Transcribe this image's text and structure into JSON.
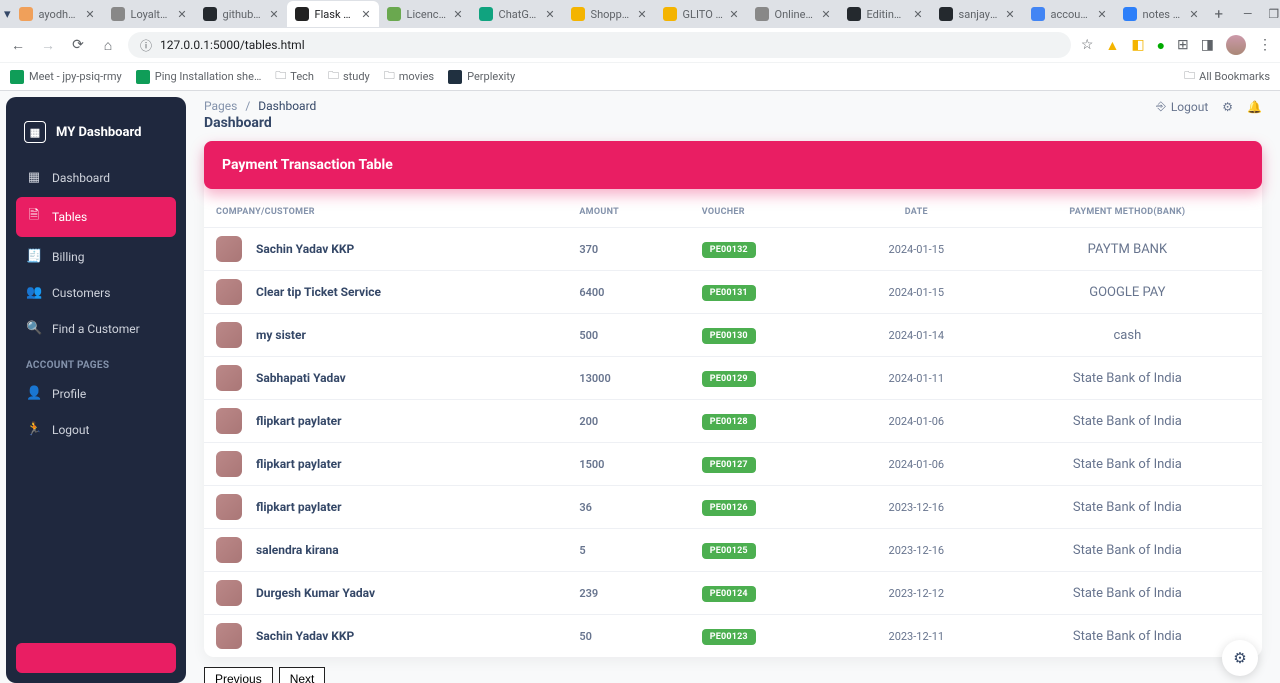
{
  "browser": {
    "tabs": [
      {
        "title": "ayodhya a",
        "favicon": "#f0a05a"
      },
      {
        "title": "Loyalty-D",
        "favicon": "#888"
      },
      {
        "title": "github.co",
        "favicon": "#24292e"
      },
      {
        "title": "Flask Mate",
        "favicon": "#222",
        "active": true
      },
      {
        "title": "Licence D",
        "favicon": "#6aa84f"
      },
      {
        "title": "ChatGPT",
        "favicon": "#10a37f"
      },
      {
        "title": "Shopping",
        "favicon": "#f4b400"
      },
      {
        "title": "GLITO Ful",
        "favicon": "#f4b400"
      },
      {
        "title": "Online MY",
        "favicon": "#888"
      },
      {
        "title": "Editing ex",
        "favicon": "#24292e"
      },
      {
        "title": "sanjayeng",
        "favicon": "#24292e"
      },
      {
        "title": "accounts",
        "favicon": "#4285f4"
      },
      {
        "title": "notes — P",
        "favicon": "#2d7ff9"
      }
    ],
    "url": "127.0.0.1:5000/tables.html",
    "bookmarks": [
      {
        "type": "item",
        "label": "Meet - jpy-psiq-rmy",
        "color": "#0f9d58"
      },
      {
        "type": "item",
        "label": "Ping Installation she…",
        "color": "#0f9d58"
      },
      {
        "type": "folder",
        "label": "Tech"
      },
      {
        "type": "folder",
        "label": "study"
      },
      {
        "type": "folder",
        "label": "movies"
      },
      {
        "type": "item",
        "label": "Perplexity",
        "color": "#203040"
      }
    ],
    "all_bookmarks": "All Bookmarks"
  },
  "sidebar": {
    "brand": "MY Dashboard",
    "items": [
      {
        "icon": "▦",
        "label": "Dashboard"
      },
      {
        "icon": "🗎",
        "label": "Tables",
        "active": true
      },
      {
        "icon": "🧾",
        "label": "Billing"
      },
      {
        "icon": "👥",
        "label": "Customers"
      },
      {
        "icon": "🔍",
        "label": "Find a Customer"
      }
    ],
    "section_label": "ACCOUNT PAGES",
    "account_items": [
      {
        "icon": "👤",
        "label": "Profile"
      },
      {
        "icon": "🏃",
        "label": "Logout"
      }
    ]
  },
  "header": {
    "breadcrumb_root": "Pages",
    "breadcrumb_current": "Dashboard",
    "title": "Dashboard",
    "logout_label": "Logout"
  },
  "card": {
    "title": "Payment Transaction Table",
    "columns": {
      "company": "COMPANY/CUSTOMER",
      "amount": "AMOUNT",
      "voucher": "VOUCHER",
      "date": "DATE",
      "method": "PAYMENT METHOD(BANK)"
    },
    "rows": [
      {
        "name": "Sachin Yadav KKP",
        "amount": "370",
        "voucher": "PE00132",
        "date": "2024-01-15",
        "method": "PAYTM BANK"
      },
      {
        "name": "Clear tip Ticket Service",
        "amount": "6400",
        "voucher": "PE00131",
        "date": "2024-01-15",
        "method": "GOOGLE PAY"
      },
      {
        "name": "my sister",
        "amount": "500",
        "voucher": "PE00130",
        "date": "2024-01-14",
        "method": "cash"
      },
      {
        "name": "Sabhapati Yadav",
        "amount": "13000",
        "voucher": "PE00129",
        "date": "2024-01-11",
        "method": "State Bank of India"
      },
      {
        "name": "flipkart paylater",
        "amount": "200",
        "voucher": "PE00128",
        "date": "2024-01-06",
        "method": "State Bank of India"
      },
      {
        "name": "flipkart paylater",
        "amount": "1500",
        "voucher": "PE00127",
        "date": "2024-01-06",
        "method": "State Bank of India"
      },
      {
        "name": "flipkart paylater",
        "amount": "36",
        "voucher": "PE00126",
        "date": "2023-12-16",
        "method": "State Bank of India"
      },
      {
        "name": "salendra kirana",
        "amount": "5",
        "voucher": "PE00125",
        "date": "2023-12-16",
        "method": "State Bank of India"
      },
      {
        "name": "Durgesh Kumar Yadav",
        "amount": "239",
        "voucher": "PE00124",
        "date": "2023-12-12",
        "method": "State Bank of India"
      },
      {
        "name": "Sachin Yadav KKP",
        "amount": "50",
        "voucher": "PE00123",
        "date": "2023-12-11",
        "method": "State Bank of India"
      }
    ]
  },
  "pagination": {
    "previous": "Previous",
    "next": "Next"
  }
}
